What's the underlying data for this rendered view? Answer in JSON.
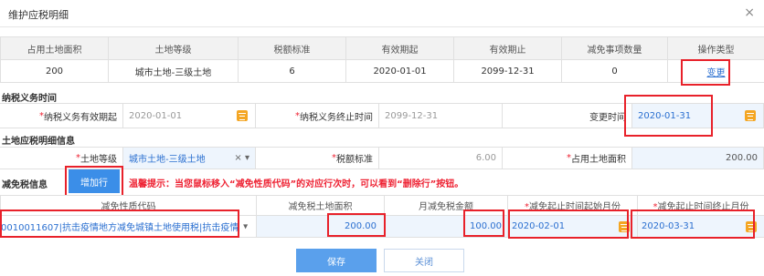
{
  "dialog": {
    "title": "维护应税明细",
    "close": "×"
  },
  "top_table": {
    "headers": [
      "占用土地面积",
      "土地等级",
      "税额标准",
      "有效期起",
      "有效期止",
      "减免事项数量",
      "操作类型"
    ],
    "row": [
      "200",
      "城市土地-三级土地",
      "6",
      "2020-01-01",
      "2099-12-31",
      "0"
    ],
    "action": "变更"
  },
  "section_duty": {
    "title": "纳税义务时间",
    "start_label": "纳税义务有效期起",
    "start_value": "2020-01-01",
    "end_label": "纳税义务终止时间",
    "end_value": "2099-12-31",
    "change_label": "变更时间",
    "change_value": "2020-01-31"
  },
  "section_land": {
    "title": "土地应税明细信息",
    "grade_label": "土地等级",
    "grade_value": "城市土地-三级土地",
    "std_label": "税额标准",
    "std_value": "6.00",
    "area_label": "占用土地面积",
    "area_value": "200.00"
  },
  "section_relief": {
    "title": "减免税信息",
    "add_button": "增加行",
    "warning": "温馨提示：当您鼠标移入“减免性质代码”的对应行次时，可以看到“删除行”按钮。",
    "headers": [
      "减免性质代码",
      "减免税土地面积",
      "月减免税金额",
      "减免起止时间起始月份",
      "减免起止时间终止月份"
    ],
    "row": {
      "code": "0010011607|抗击疫情地方减免城镇土地使用税|抗击疫情",
      "area": "200.00",
      "amount": "100.00",
      "start": "2020-02-01",
      "end": "2020-03-31"
    }
  },
  "footer": {
    "save": "保存",
    "close": "关闭"
  },
  "colors": {
    "accent": "#3b8ee8",
    "highlight": "#e8212a",
    "required": "#e23"
  }
}
